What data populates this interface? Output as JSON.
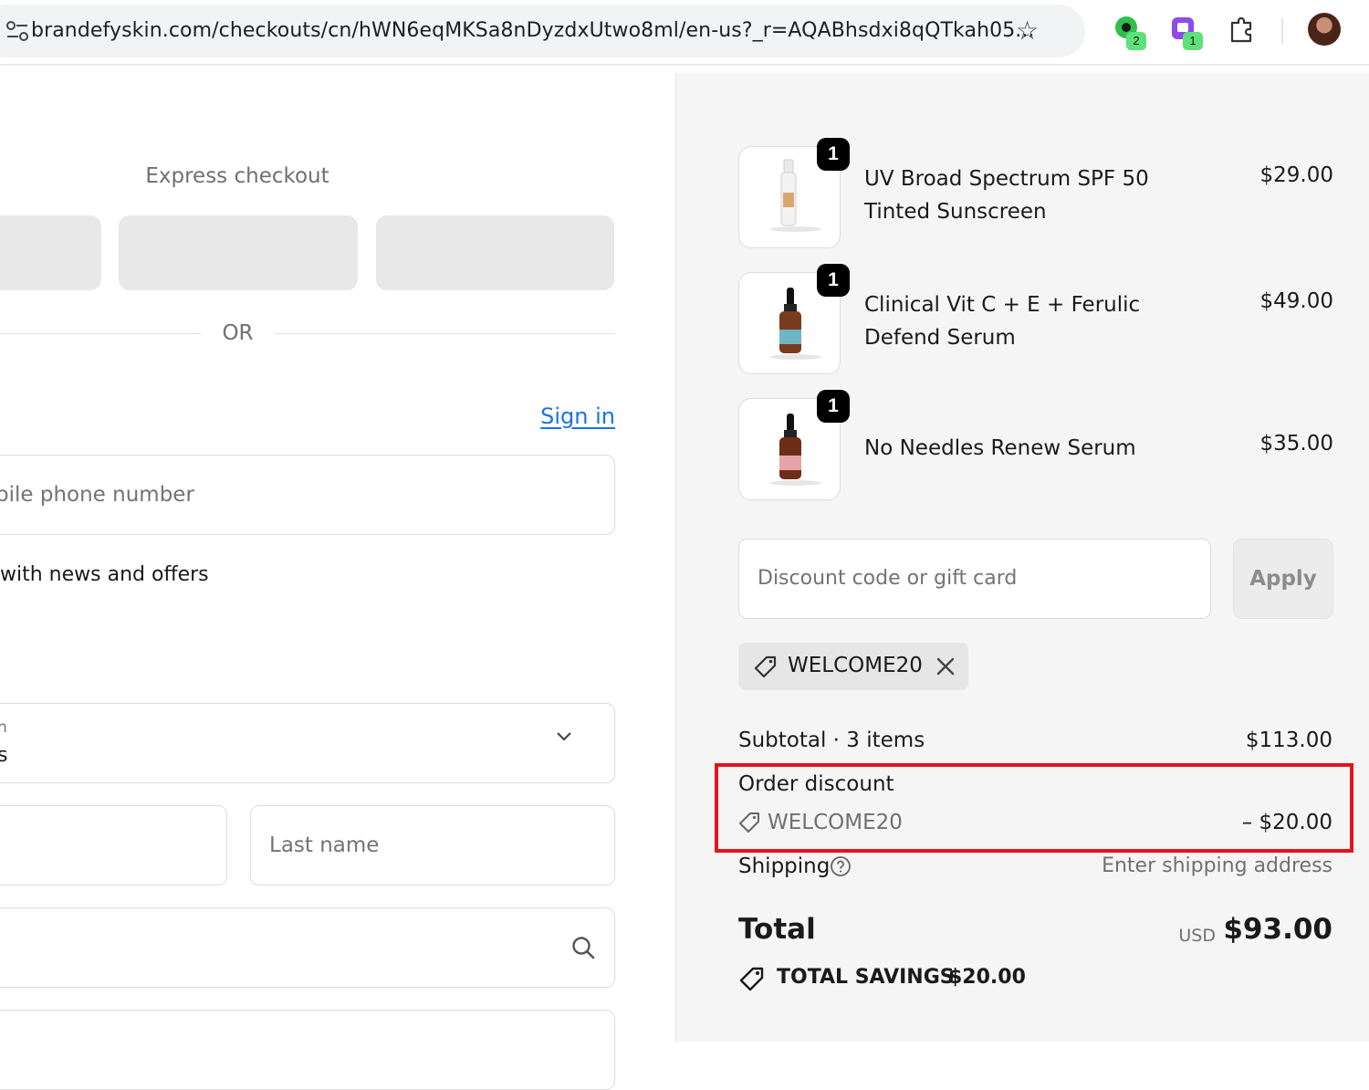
{
  "browser": {
    "url": "brandefyskin.com/checkouts/cn/hWN6eqMKSa8nDyzdxUtwo8ml/en-us?_r=AQABhsdxi8qQTkah05...",
    "extensions": [
      {
        "icon": "extension-chat-icon",
        "badge": "2"
      },
      {
        "icon": "extension-app-icon",
        "badge": "1"
      }
    ]
  },
  "checkout": {
    "express_title": "Express checkout",
    "or_label": "OR",
    "sign_in": "Sign in",
    "phone_placeholder": "bile phone number",
    "news_label": "with news and offers",
    "country_label": "n",
    "country_value": "s",
    "last_name_placeholder": "Last name"
  },
  "summary": {
    "items": [
      {
        "name": "UV Broad Spectrum SPF 50 Tinted Sunscreen",
        "price": "$29.00",
        "qty": "1"
      },
      {
        "name": "Clinical Vit C + E + Ferulic Defend Serum",
        "price": "$49.00",
        "qty": "1"
      },
      {
        "name": "No Needles Renew Serum",
        "price": "$35.00",
        "qty": "1"
      }
    ],
    "discount_placeholder": "Discount code or gift card",
    "apply_label": "Apply",
    "applied_code": "WELCOME20",
    "subtotal_label": "Subtotal · 3 items",
    "subtotal_value": "$113.00",
    "order_discount_label": "Order discount",
    "order_discount_code": "WELCOME20",
    "order_discount_value": "– $20.00",
    "shipping_label": "Shipping",
    "shipping_value": "Enter shipping address",
    "total_label": "Total",
    "currency": "USD",
    "total_value": "$93.00",
    "savings_label": "Total savings",
    "savings_value": "$20.00"
  },
  "colors": {
    "highlight": "#e3141b",
    "link": "#1a73e8",
    "summary_bg": "#f5f5f5"
  }
}
